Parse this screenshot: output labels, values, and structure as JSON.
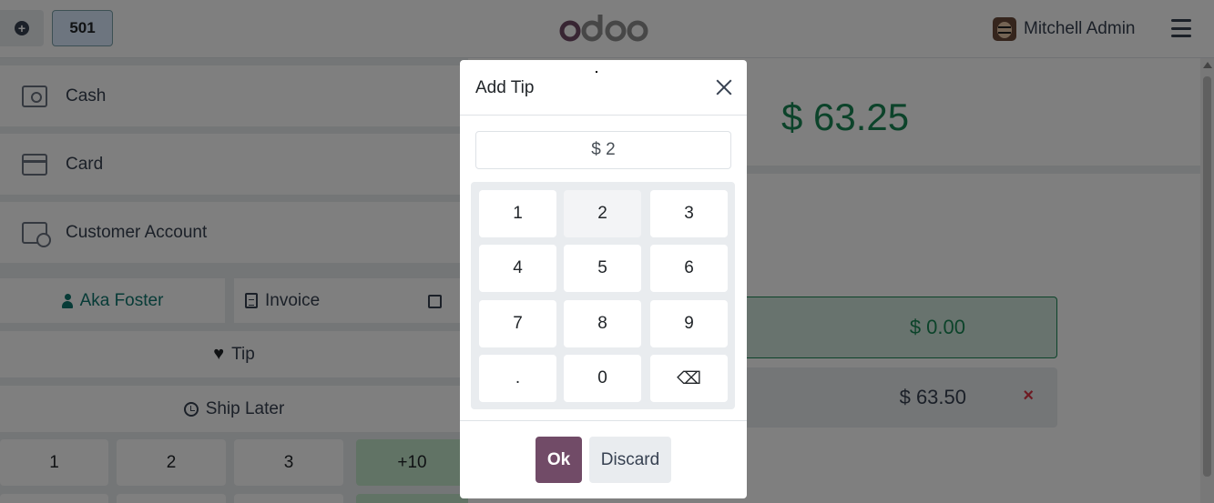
{
  "header": {
    "table_number": "501",
    "logo_text": "odoo",
    "user_name": "Mitchell Admin"
  },
  "payment_methods": [
    {
      "label": "Cash",
      "icon": "cash-icon"
    },
    {
      "label": "Card",
      "icon": "card-icon"
    },
    {
      "label": "Customer Account",
      "icon": "customer-account-icon"
    }
  ],
  "actions": {
    "customer": "Aka Foster",
    "invoice": "Invoice",
    "tip": "Tip",
    "ship_later": "Ship Later"
  },
  "numpad_bg": [
    "1",
    "2",
    "3",
    "+10"
  ],
  "summary": {
    "total": "$ 63.25",
    "line1_amount": "$ 0.00",
    "line2_amount": "$ 63.50",
    "remove_symbol": "×"
  },
  "modal": {
    "title": "Add Tip",
    "input_value": "$ 2",
    "keys": [
      "1",
      "2",
      "3",
      "4",
      "5",
      "6",
      "7",
      "8",
      "9",
      ".",
      "0",
      "⌫"
    ],
    "ok_label": "Ok",
    "discard_label": "Discard"
  },
  "colors": {
    "brand": "#714b67",
    "success": "#198754",
    "danger": "#dc3545"
  }
}
